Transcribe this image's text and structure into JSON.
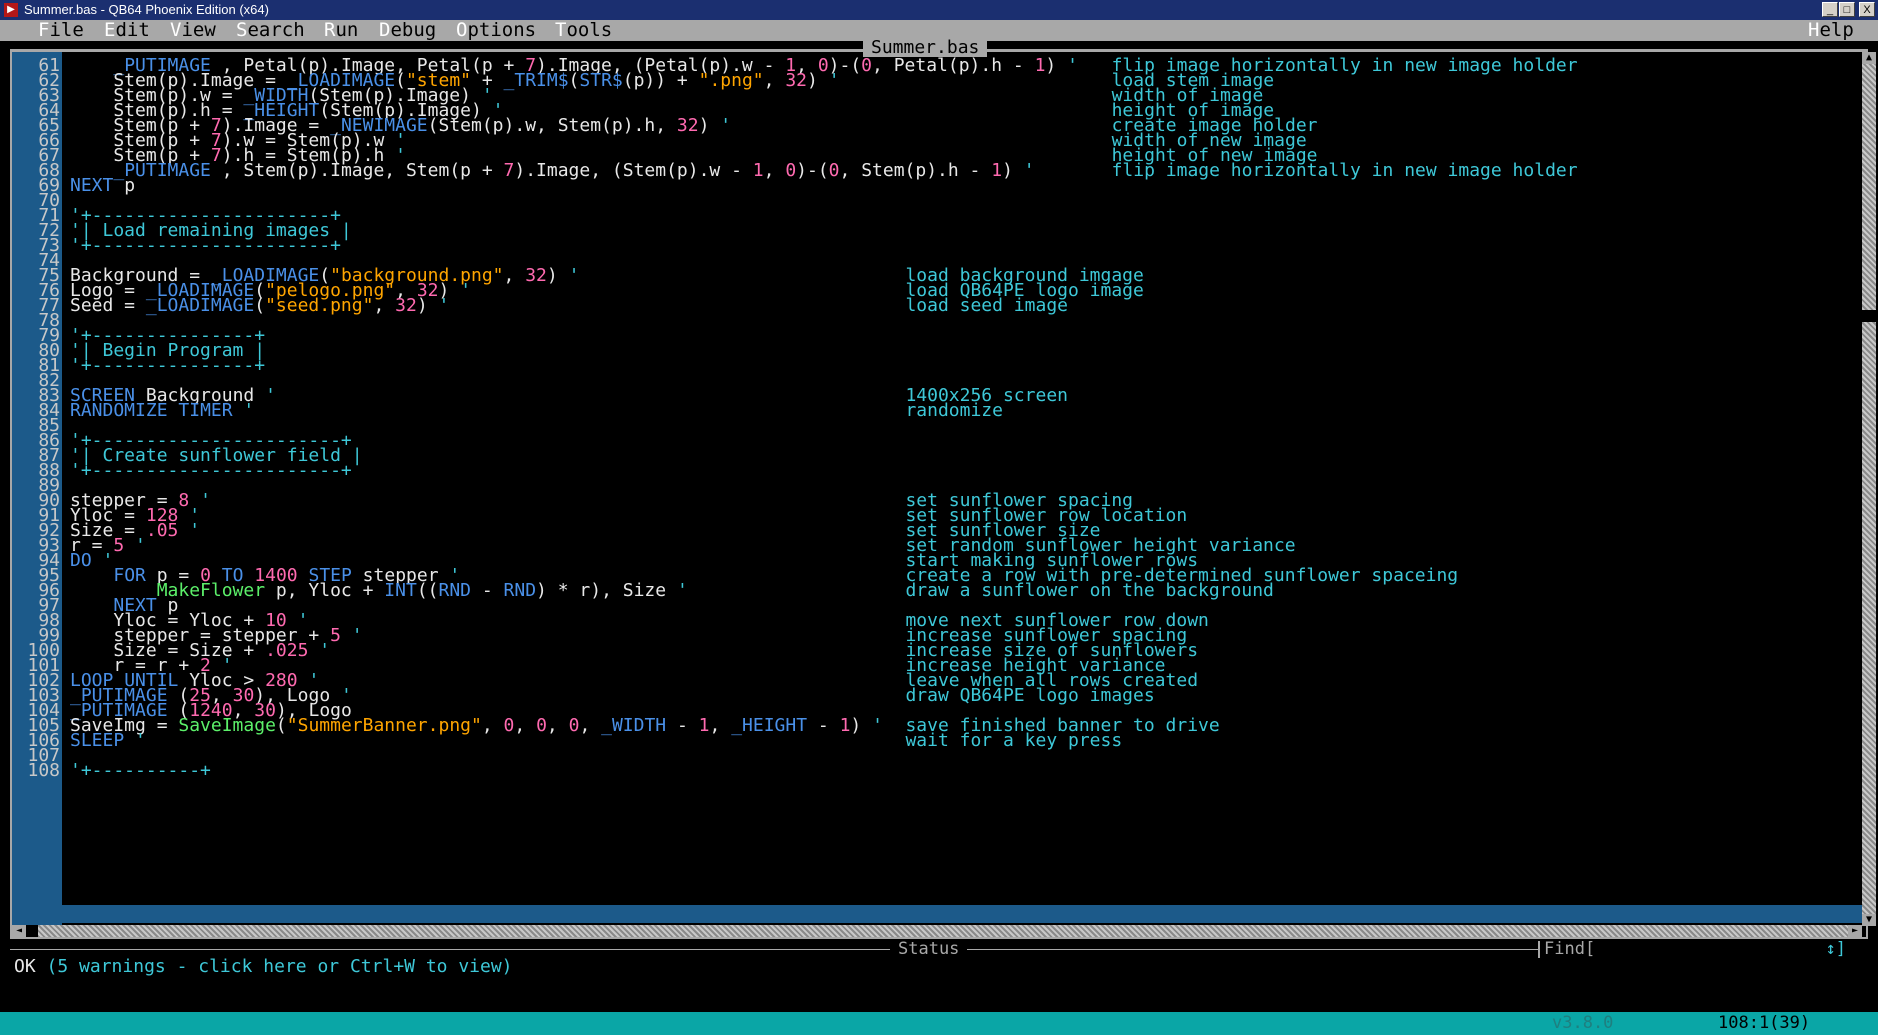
{
  "window": {
    "title": "Summer.bas - QB64 Phoenix Edition (x64)",
    "minimize": "_",
    "maximize": "□",
    "close": "X"
  },
  "menu": [
    {
      "hotkey": "F",
      "rest": "ile"
    },
    {
      "hotkey": "E",
      "rest": "dit"
    },
    {
      "hotkey": "V",
      "rest": "iew"
    },
    {
      "hotkey": "S",
      "rest": "earch"
    },
    {
      "hotkey": "R",
      "rest": "un"
    },
    {
      "hotkey": "D",
      "rest": "ebug"
    },
    {
      "hotkey": "O",
      "rest": "ptions"
    },
    {
      "hotkey": "T",
      "rest": "ools"
    }
  ],
  "menu_help": {
    "hotkey": "H",
    "rest": "elp"
  },
  "editor": {
    "file_tab": "Summer.bas",
    "lines": [
      {
        "n": "61",
        "code": "    _PUTIMAGE , Petal(p).Image, Petal(p + 7).Image, (Petal(p).w - 1, 0)-(0, Petal(p).h - 1) '",
        "comment": "flip image horizontally in new image holder",
        "ccol": 96
      },
      {
        "n": "62",
        "code": "    Stem(p).Image = _LOADIMAGE(\"stem\" + _TRIM$(STR$(p)) + \".png\", 32) '",
        "comment": "load stem image",
        "ccol": 96
      },
      {
        "n": "63",
        "code": "    Stem(p).w = _WIDTH(Stem(p).Image) '",
        "comment": "width of image",
        "ccol": 96
      },
      {
        "n": "64",
        "code": "    Stem(p).h = _HEIGHT(Stem(p).Image) '",
        "comment": "height of image",
        "ccol": 96
      },
      {
        "n": "65",
        "code": "    Stem(p + 7).Image = _NEWIMAGE(Stem(p).w, Stem(p).h, 32) '",
        "comment": "create image holder",
        "ccol": 96
      },
      {
        "n": "66",
        "code": "    Stem(p + 7).w = Stem(p).w '",
        "comment": "width of new image",
        "ccol": 96
      },
      {
        "n": "67",
        "code": "    Stem(p + 7).h = Stem(p).h '",
        "comment": "height of new image",
        "ccol": 96
      },
      {
        "n": "68",
        "code": "    _PUTIMAGE , Stem(p).Image, Stem(p + 7).Image, (Stem(p).w - 1, 0)-(0, Stem(p).h - 1) '",
        "comment": "flip image horizontally in new image holder",
        "ccol": 96
      },
      {
        "n": "69",
        "code": "NEXT p",
        "comment": "",
        "ccol": 0
      },
      {
        "n": "70",
        "code": "",
        "comment": "",
        "ccol": 0
      },
      {
        "n": "71",
        "code": "'+----------------------+",
        "comment": "",
        "ccol": 0,
        "all_comment": true
      },
      {
        "n": "72",
        "code": "'| Load remaining images |",
        "comment": "",
        "ccol": 0,
        "all_comment": true
      },
      {
        "n": "73",
        "code": "'+----------------------+",
        "comment": "",
        "ccol": 0,
        "all_comment": true
      },
      {
        "n": "74",
        "code": "",
        "comment": "",
        "ccol": 0
      },
      {
        "n": "75",
        "code": "Background = _LOADIMAGE(\"background.png\", 32) '",
        "comment": "load background imgage",
        "ccol": 77
      },
      {
        "n": "76",
        "code": "Logo = _LOADIMAGE(\"pelogo.png\", 32) '",
        "comment": "load QB64PE logo image",
        "ccol": 77
      },
      {
        "n": "77",
        "code": "Seed = _LOADIMAGE(\"seed.png\", 32) '",
        "comment": "load seed image",
        "ccol": 77
      },
      {
        "n": "78",
        "code": "",
        "comment": "",
        "ccol": 0
      },
      {
        "n": "79",
        "code": "'+---------------+",
        "comment": "",
        "ccol": 0,
        "all_comment": true
      },
      {
        "n": "80",
        "code": "'| Begin Program |",
        "comment": "",
        "ccol": 0,
        "all_comment": true
      },
      {
        "n": "81",
        "code": "'+---------------+",
        "comment": "",
        "ccol": 0,
        "all_comment": true
      },
      {
        "n": "82",
        "code": "",
        "comment": "",
        "ccol": 0
      },
      {
        "n": "83",
        "code": "SCREEN Background '",
        "comment": "1400x256 screen",
        "ccol": 77
      },
      {
        "n": "84",
        "code": "RANDOMIZE TIMER '",
        "comment": "randomize",
        "ccol": 77
      },
      {
        "n": "85",
        "code": "",
        "comment": "",
        "ccol": 0
      },
      {
        "n": "86",
        "code": "'+-----------------------+",
        "comment": "",
        "ccol": 0,
        "all_comment": true
      },
      {
        "n": "87",
        "code": "'| Create sunflower field |",
        "comment": "",
        "ccol": 0,
        "all_comment": true
      },
      {
        "n": "88",
        "code": "'+-----------------------+",
        "comment": "",
        "ccol": 0,
        "all_comment": true
      },
      {
        "n": "89",
        "code": "",
        "comment": "",
        "ccol": 0
      },
      {
        "n": "90",
        "code": "stepper = 8 '",
        "comment": "set sunflower spacing",
        "ccol": 77
      },
      {
        "n": "91",
        "code": "Yloc = 128 '",
        "comment": "set sunflower row location",
        "ccol": 77
      },
      {
        "n": "92",
        "code": "Size = .05 '",
        "comment": "set sunflower size",
        "ccol": 77
      },
      {
        "n": "93",
        "code": "r = 5 '",
        "comment": "set random sunflower height variance",
        "ccol": 77
      },
      {
        "n": "94",
        "code": "DO '",
        "comment": "start making sunflower rows",
        "ccol": 77
      },
      {
        "n": "95",
        "code": "    FOR p = 0 TO 1400 STEP stepper '",
        "comment": "create a row with pre-determined sunflower spaceing",
        "ccol": 77
      },
      {
        "n": "96",
        "code": "        MakeFlower p, Yloc + INT((RND - RND) * r), Size '",
        "comment": "draw a sunflower on the background",
        "ccol": 77
      },
      {
        "n": "97",
        "code": "    NEXT p",
        "comment": "",
        "ccol": 0
      },
      {
        "n": "98",
        "code": "    Yloc = Yloc + 10 '",
        "comment": "move next sunflower row down",
        "ccol": 77
      },
      {
        "n": "99",
        "code": "    stepper = stepper + 5 '",
        "comment": "increase sunflower spacing",
        "ccol": 77
      },
      {
        "n": "100",
        "code": "    Size = Size + .025 '",
        "comment": "increase size of sunflowers",
        "ccol": 77
      },
      {
        "n": "101",
        "code": "    r = r + 2 '",
        "comment": "increase height variance",
        "ccol": 77
      },
      {
        "n": "102",
        "code": "LOOP UNTIL Yloc > 280 '",
        "comment": "leave when all rows created",
        "ccol": 77
      },
      {
        "n": "103",
        "code": "_PUTIMAGE (25, 30), Logo '",
        "comment": "draw QB64PE logo images",
        "ccol": 77
      },
      {
        "n": "104",
        "code": "_PUTIMAGE (1240, 30), Logo",
        "comment": "",
        "ccol": 0
      },
      {
        "n": "105",
        "code": "SaveImg = SaveImage(\"SummerBanner.png\", 0, 0, 0, _WIDTH - 1, _HEIGHT - 1) '",
        "comment": "save finished banner to drive",
        "ccol": 77
      },
      {
        "n": "106",
        "code": "SLEEP '",
        "comment": "wait for a key press",
        "ccol": 77
      },
      {
        "n": "107",
        "code": "",
        "comment": "",
        "ccol": 0
      },
      {
        "n": "108",
        "code": "'+----------+",
        "comment": "",
        "ccol": 0,
        "all_comment": true
      }
    ]
  },
  "status": {
    "label": "Status",
    "ok": "OK",
    "warnings": "(5 warnings - click here or Ctrl+W to view)",
    "find_label": "Find[",
    "find_end": "↕]"
  },
  "footer": {
    "version": "v3.8.0",
    "cursor": "108:1(39)"
  },
  "colors": {
    "keyword": "#4a90e8",
    "string": "#ffa500",
    "number": "#ff6ab0",
    "sub": "#5cf06a",
    "comment": "#3ec8d8",
    "text": "#e8e8e8"
  }
}
